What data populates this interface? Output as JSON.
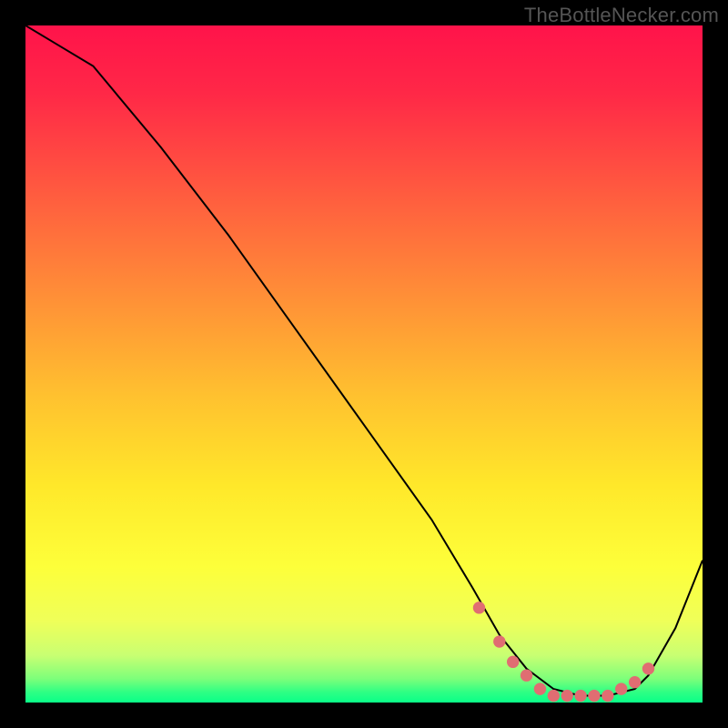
{
  "watermark": "TheBottleNecker.com",
  "colors": {
    "bg": "#000000",
    "curve": "#000000",
    "marker": "#e06d72",
    "gradient_stops": [
      {
        "offset": 0.0,
        "color": "#ff134a"
      },
      {
        "offset": 0.1,
        "color": "#ff2847"
      },
      {
        "offset": 0.25,
        "color": "#ff5c3f"
      },
      {
        "offset": 0.4,
        "color": "#ff8f37"
      },
      {
        "offset": 0.55,
        "color": "#ffc22f"
      },
      {
        "offset": 0.68,
        "color": "#ffe82a"
      },
      {
        "offset": 0.8,
        "color": "#fdff3a"
      },
      {
        "offset": 0.88,
        "color": "#efff59"
      },
      {
        "offset": 0.93,
        "color": "#c9ff72"
      },
      {
        "offset": 0.965,
        "color": "#7dff7a"
      },
      {
        "offset": 0.985,
        "color": "#2dff84"
      },
      {
        "offset": 1.0,
        "color": "#0aff88"
      }
    ]
  },
  "chart_data": {
    "type": "line",
    "title": "",
    "xlabel": "",
    "ylabel": "",
    "xlim": [
      0,
      100
    ],
    "ylim": [
      0,
      100
    ],
    "grid": false,
    "legend": false,
    "series": [
      {
        "name": "curve",
        "x": [
          0,
          5,
          10,
          20,
          30,
          40,
          50,
          60,
          66,
          70,
          74,
          78,
          82,
          86,
          90,
          92,
          96,
          100
        ],
        "y": [
          100,
          97,
          94,
          82,
          69,
          55,
          41,
          27,
          17,
          10,
          5,
          2,
          1,
          1,
          2,
          4,
          11,
          21
        ]
      }
    ],
    "markers": {
      "name": "highlight-points",
      "x": [
        67,
        70,
        72,
        74,
        76,
        78,
        80,
        82,
        84,
        86,
        88,
        90,
        92
      ],
      "y": [
        14,
        9,
        6,
        4,
        2,
        1,
        1,
        1,
        1,
        1,
        2,
        3,
        5
      ]
    }
  }
}
